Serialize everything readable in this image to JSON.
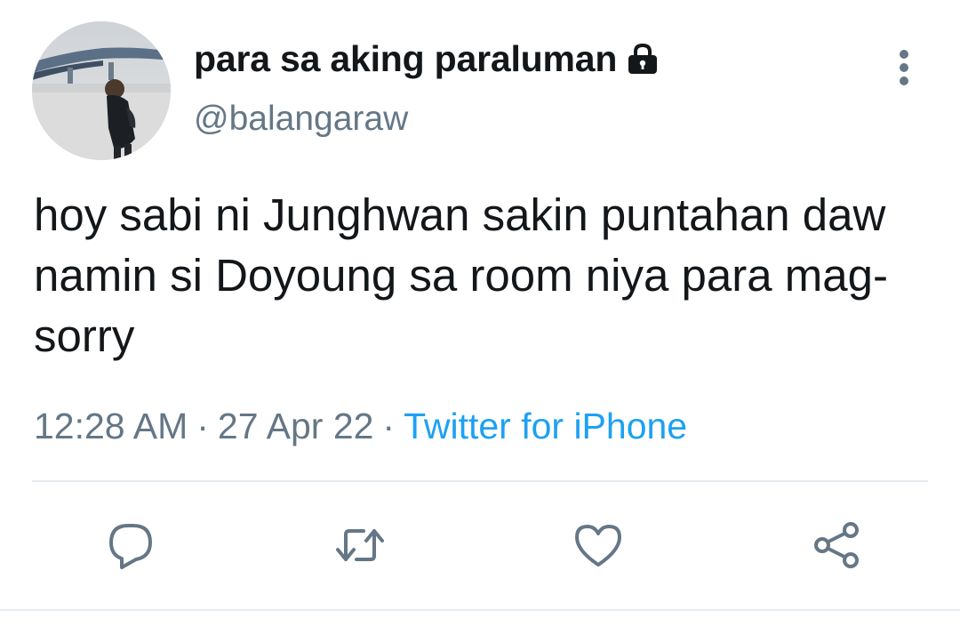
{
  "tweet": {
    "display_name": "para sa aking paraluman",
    "handle": "@balangaraw",
    "protected_icon": "lock-icon",
    "more_icon": "vertical-ellipsis-icon",
    "text": "hoy sabi ni Junghwan sakin puntahan daw namin si Doyoung sa room niya para mag-sorry",
    "time": "12:28 AM",
    "date": "27 Apr 22",
    "separator": "·",
    "source": "Twitter for iPhone"
  },
  "actions": [
    {
      "name": "reply",
      "icon": "reply-bubble-icon"
    },
    {
      "name": "retweet",
      "icon": "retweet-icon"
    },
    {
      "name": "like",
      "icon": "heart-icon"
    },
    {
      "name": "share",
      "icon": "share-icon"
    }
  ],
  "colors": {
    "text": "#14171a",
    "secondary": "#657786",
    "link": "#1da1f2",
    "divider": "#e6ecf0",
    "icon": "#657786"
  }
}
